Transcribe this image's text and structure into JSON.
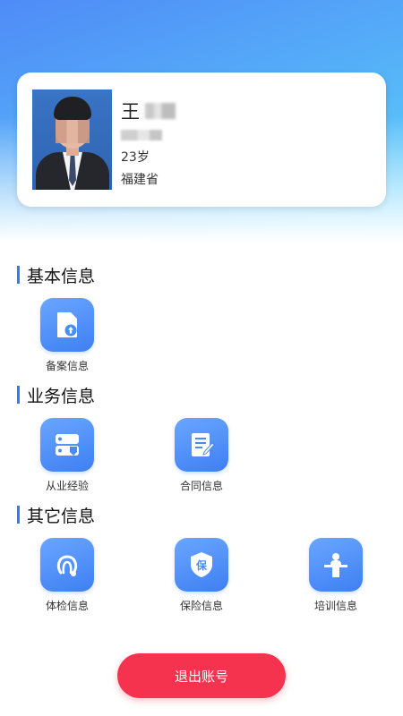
{
  "profile": {
    "surname": "王",
    "age": "23岁",
    "province": "福建省"
  },
  "sections": [
    {
      "title": "基本信息",
      "items": [
        {
          "label": "备案信息",
          "icon": "upload-file-icon"
        }
      ]
    },
    {
      "title": "业务信息",
      "items": [
        {
          "label": "从业经验",
          "icon": "experience-icon"
        },
        {
          "label": "合同信息",
          "icon": "contract-icon"
        }
      ]
    },
    {
      "title": "其它信息",
      "items": [
        {
          "label": "体检信息",
          "icon": "stethoscope-icon"
        },
        {
          "label": "保险信息",
          "icon": "insurance-shield-icon"
        },
        {
          "label": "培训信息",
          "icon": "training-podium-icon"
        }
      ]
    }
  ],
  "logout_label": "退出账号",
  "colors": {
    "accent": "#2e7cf6",
    "icon_tile": "#4a8cf6",
    "logout": "#f5334e"
  }
}
